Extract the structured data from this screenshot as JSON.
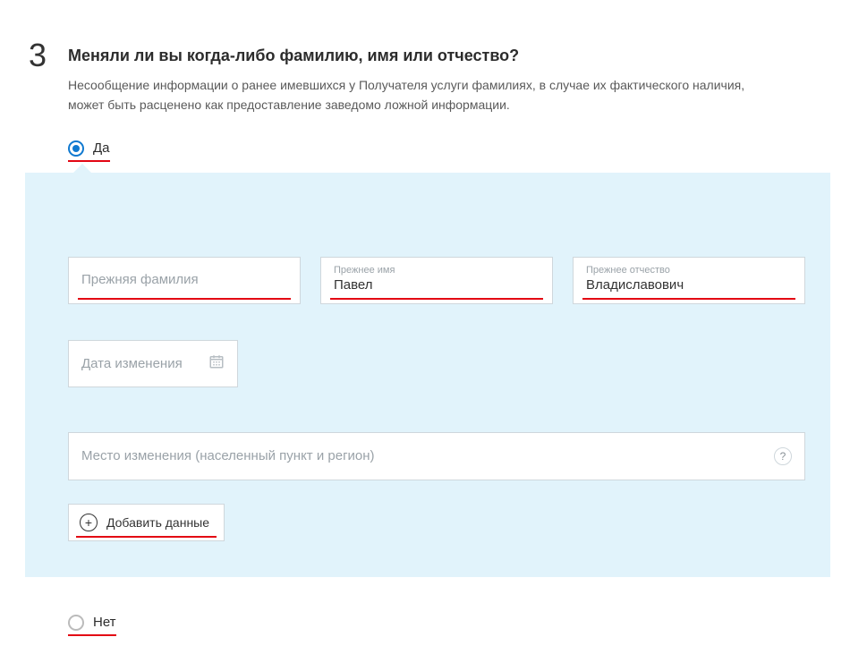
{
  "step": {
    "number": "3",
    "question": "Меняли ли вы когда-либо фамилию, имя или отчество?",
    "description": "Несообщение информации о ранее имевшихся у Получателя услуги фамилиях, в случае их фактического наличия, может быть расценено как предоставление заведомо ложной информации."
  },
  "options": {
    "yes": "Да",
    "no": "Нет"
  },
  "fields": {
    "prev_surname": {
      "placeholder": "Прежняя фамилия",
      "value": ""
    },
    "prev_name": {
      "label": "Прежнее имя",
      "value": "Павел"
    },
    "prev_patronymic": {
      "label": "Прежнее отчество",
      "value": "Владиславович"
    },
    "change_date": {
      "placeholder": "Дата изменения"
    },
    "change_place": {
      "placeholder": "Место изменения (населенный пункт и регион)"
    }
  },
  "buttons": {
    "add_data": "Добавить данные"
  },
  "help_symbol": "?"
}
